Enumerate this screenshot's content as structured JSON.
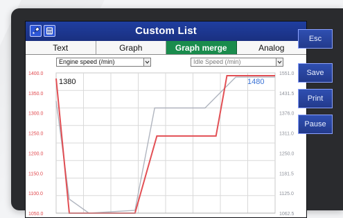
{
  "window": {
    "title": "Custom List"
  },
  "tabs": [
    {
      "label": "Text",
      "active": false
    },
    {
      "label": "Graph",
      "active": false
    },
    {
      "label": "Graph merge",
      "active": true
    },
    {
      "label": "Analog",
      "active": false
    }
  ],
  "selectors": {
    "left": {
      "value": "Engine speed (/min)"
    },
    "right": {
      "value": "Idle Speed (/min)"
    }
  },
  "graph": {
    "left_readout": "1380",
    "right_readout": "1480",
    "left_axis_ticks": [
      "1400.0",
      "1350.0",
      "1300.0",
      "1250.0",
      "1200.0",
      "1150.0",
      "1100.0",
      "1050.0"
    ],
    "right_axis_ticks": [
      "1551.0",
      "1431.5",
      "1376.0",
      "1311.0",
      "1250.0",
      "1181.5",
      "1125.0",
      "1062.5"
    ],
    "series": [
      {
        "name": "Engine speed (/min)",
        "color": "#e0464b"
      },
      {
        "name": "Idle Speed (/min)",
        "color": "#a7adb8"
      }
    ]
  },
  "side_buttons": [
    {
      "label": "Esc"
    },
    {
      "label": "Save"
    },
    {
      "label": "Print"
    },
    {
      "label": "Pause"
    }
  ],
  "colors": {
    "titlebar": "#1f3ea0",
    "active_tab": "#1a8c4d",
    "red_series": "#e0464b",
    "gray_series": "#a7adb8",
    "grid": "#d9d9d9",
    "bezel": "#2a2b2e",
    "button_blue": "#2f4fb1"
  }
}
